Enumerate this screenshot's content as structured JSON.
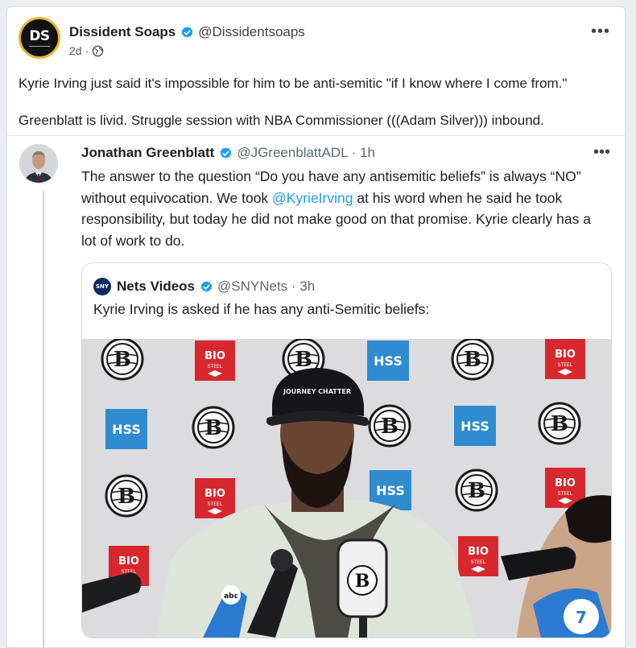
{
  "post": {
    "author": {
      "initials": "DS",
      "display_name": "Dissident Soaps",
      "handle": "@Dissidentsoaps",
      "time": "2d",
      "visibility_icon": "globe-icon"
    },
    "more_icon": "more-icon",
    "paragraphs": [
      "Kyrie Irving just said it's impossible for him to be anti-semitic \"if I know where I come from.\"",
      "Greenblatt is livid. Struggle session with NBA Commissioner (((Adam Silver))) inbound."
    ]
  },
  "embedded_tweet": {
    "display_name": "Jonathan Greenblatt",
    "handle_time": "@JGreenblattADL · 1h",
    "text_before": "The answer to the question “Do you have any antisemitic beliefs” is always “NO” without equivocation. We took ",
    "mention": "@KyrieIrving",
    "text_after": " at his word when he said he took responsibility, but today he did not make good on that promise. Kyrie clearly has a lot of work to do.",
    "quoted": {
      "logo_text": "SNY",
      "display_name": "Nets Videos",
      "handle_time": "@SNYNets · 3h",
      "text": "Kyrie Irving is asked if he has any anti-Semitic beliefs:",
      "video": {
        "backdrop_labels": [
          "BIO STEEL",
          "HSS"
        ],
        "cap_text": "JOURNEY CHATTER",
        "mic_label": "abc"
      }
    }
  },
  "colors": {
    "verified": "#1d9bf0",
    "link": "#1d9bf0",
    "brand_gold": "#e3b82c",
    "biosteel_red": "#d7282f",
    "hss_blue": "#2e8ccf"
  }
}
